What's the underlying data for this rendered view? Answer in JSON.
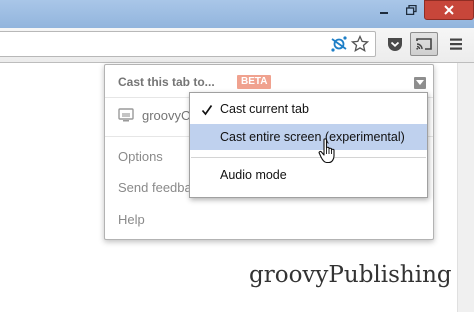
{
  "window": {
    "controls": [
      "minimize-icon",
      "maximize-icon",
      "close-icon"
    ]
  },
  "toolbar": {
    "address_value": "",
    "icons": [
      "extension-icon",
      "star-icon",
      "pocket-icon",
      "cast-icon",
      "menu-icon"
    ]
  },
  "cast_popup": {
    "title": "Cast this tab to...",
    "badge": "BETA",
    "device_name": "groovyC",
    "links": {
      "options": "Options",
      "feedback": "Send feedba",
      "help": "Help"
    }
  },
  "cast_menu": {
    "items": [
      {
        "label": "Cast current tab",
        "checked": true
      },
      {
        "label": "Cast entire screen (experimental)",
        "highlighted": true
      },
      {
        "label": "Audio mode"
      }
    ]
  },
  "watermark": "groovyPublishing",
  "colors": {
    "close_button": "#c7463a",
    "beta_badge": "#f0a28f",
    "highlight": "#bfd1ee",
    "title_bar": "#a9c6e8"
  }
}
